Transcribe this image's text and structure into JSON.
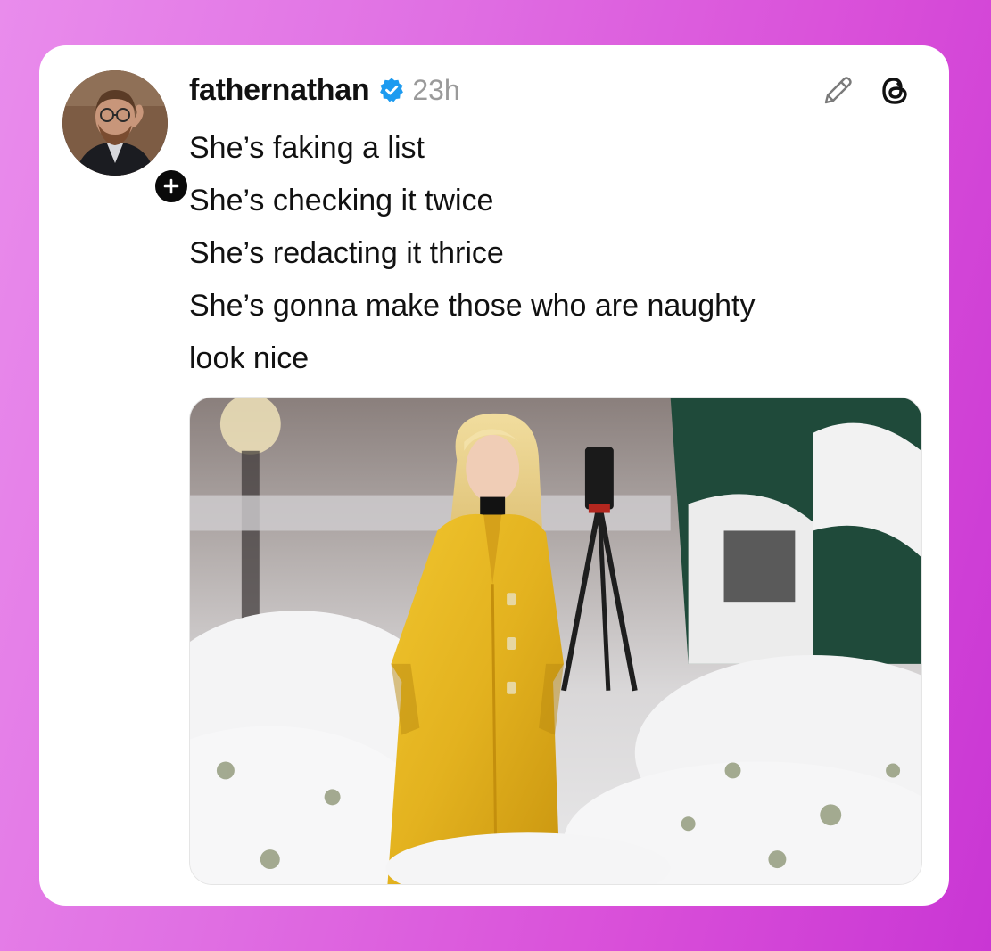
{
  "post": {
    "username": "fathernathan",
    "timestamp": "23h",
    "verified_icon": "verified-badge-icon",
    "lines": [
      "She’s faking a list",
      "She’s checking it twice",
      "She’s redacting it thrice",
      "She’s gonna make those who are naughty",
      "look nice"
    ],
    "icons": {
      "edit": "pencil-icon",
      "app": "threads-logo-icon",
      "follow": "plus-icon"
    }
  },
  "colors": {
    "verified_blue": "#1d9bf0",
    "coat_yellow": "#e3b21f",
    "gradient_start": "#e98cec",
    "gradient_end": "#c936d4"
  }
}
